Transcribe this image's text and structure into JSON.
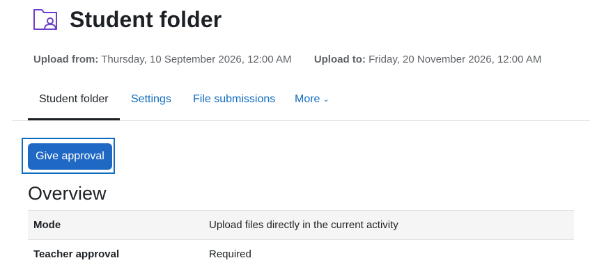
{
  "page": {
    "title": "Student folder",
    "icon": "folder-user-icon",
    "accent_color": "#6c3fc8"
  },
  "dates": {
    "upload_from_label": "Upload from:",
    "upload_from_value": "Thursday, 10 September 2026, 12:00 AM",
    "upload_to_label": "Upload to:",
    "upload_to_value": "Friday, 20 November 2026, 12:00 AM"
  },
  "tabs": [
    {
      "label": "Student folder",
      "active": true
    },
    {
      "label": "Settings",
      "active": false
    },
    {
      "label": "File submissions",
      "active": false
    },
    {
      "label": "More",
      "active": false,
      "icon": "chevron-down-icon"
    }
  ],
  "actions": {
    "give_approval_label": "Give approval",
    "primary_color": "#1f68c4"
  },
  "overview": {
    "heading": "Overview",
    "rows": [
      {
        "key": "Mode",
        "value": "Upload files directly in the current activity"
      },
      {
        "key": "Teacher approval",
        "value": "Required"
      }
    ]
  }
}
